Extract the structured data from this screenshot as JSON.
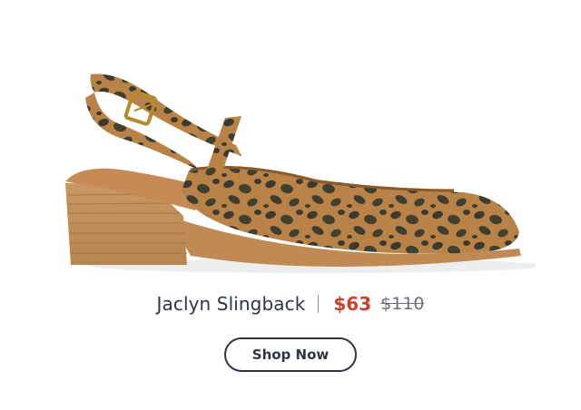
{
  "product": {
    "name": "Jaclyn Slingback",
    "sale_price": "$63",
    "original_price": "$110"
  },
  "cta": {
    "label": "Shop Now"
  },
  "colors": {
    "text_primary": "#2f3542",
    "sale_price": "#c8402e",
    "original_price": "#6a6f78",
    "leopard_base": "#b98348",
    "heel_wood": "#c4925f"
  }
}
